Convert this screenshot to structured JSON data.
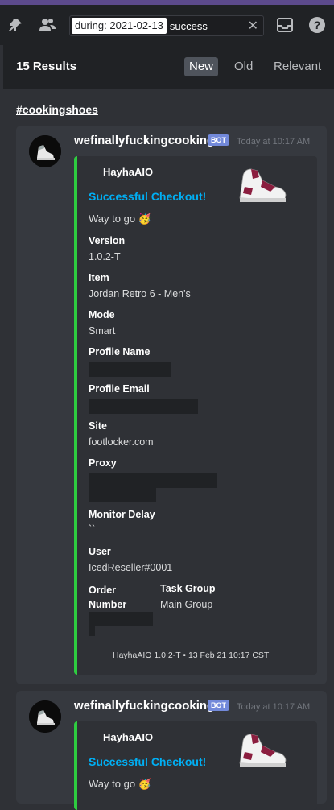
{
  "topbar": {
    "search_chip": "during: 2021-02-13",
    "search_text": "success",
    "icons": [
      "pin-icon",
      "members-icon",
      "inbox-icon",
      "help-icon"
    ]
  },
  "results": {
    "count_label": "15 Results",
    "sort": [
      {
        "label": "New",
        "active": true
      },
      {
        "label": "Old",
        "active": false
      },
      {
        "label": "Relevant",
        "active": false
      }
    ],
    "channel": "#cookingshoes"
  },
  "messages": [
    {
      "author": "wefinallyfuckingcooking",
      "badge": "BOT",
      "timestamp": "Today at 10:17 AM",
      "embed": {
        "author": "HayhaAIO",
        "title": "Successful Checkout!",
        "description": "Way to go",
        "emoji": "🥳",
        "fields": [
          {
            "name": "Version",
            "value": "1.0.2-T"
          },
          {
            "name": "Item",
            "value": "Jordan Retro 6 - Men's"
          },
          {
            "name": "Mode",
            "value": "Smart"
          },
          {
            "name": "Profile Name",
            "value": ""
          },
          {
            "name": "Profile Email",
            "value": ""
          },
          {
            "name": "Site",
            "value": "footlocker.com"
          },
          {
            "name": "Proxy",
            "value": ""
          },
          {
            "name": "Monitor Delay",
            "value": "``"
          },
          {
            "name": "User",
            "value": "IcedReseller#0001"
          },
          {
            "name": "Order Number",
            "value": ""
          },
          {
            "name": "Task Group",
            "value": "Main Group"
          }
        ],
        "footer": "HayhaAIO 1.0.2-T • 13 Feb 21 10:17 CST",
        "accent": "#2ecc40"
      }
    },
    {
      "author": "wefinallyfuckingcooking",
      "badge": "BOT",
      "timestamp": "Today at 10:17 AM",
      "embed": {
        "author": "HayhaAIO",
        "title": "Successful Checkout!",
        "description": "Way to go",
        "emoji": "🥳"
      }
    }
  ],
  "colors": {
    "accent_green": "#2ecc40",
    "link_blue": "#00aff4",
    "bot_badge": "#7289da"
  }
}
